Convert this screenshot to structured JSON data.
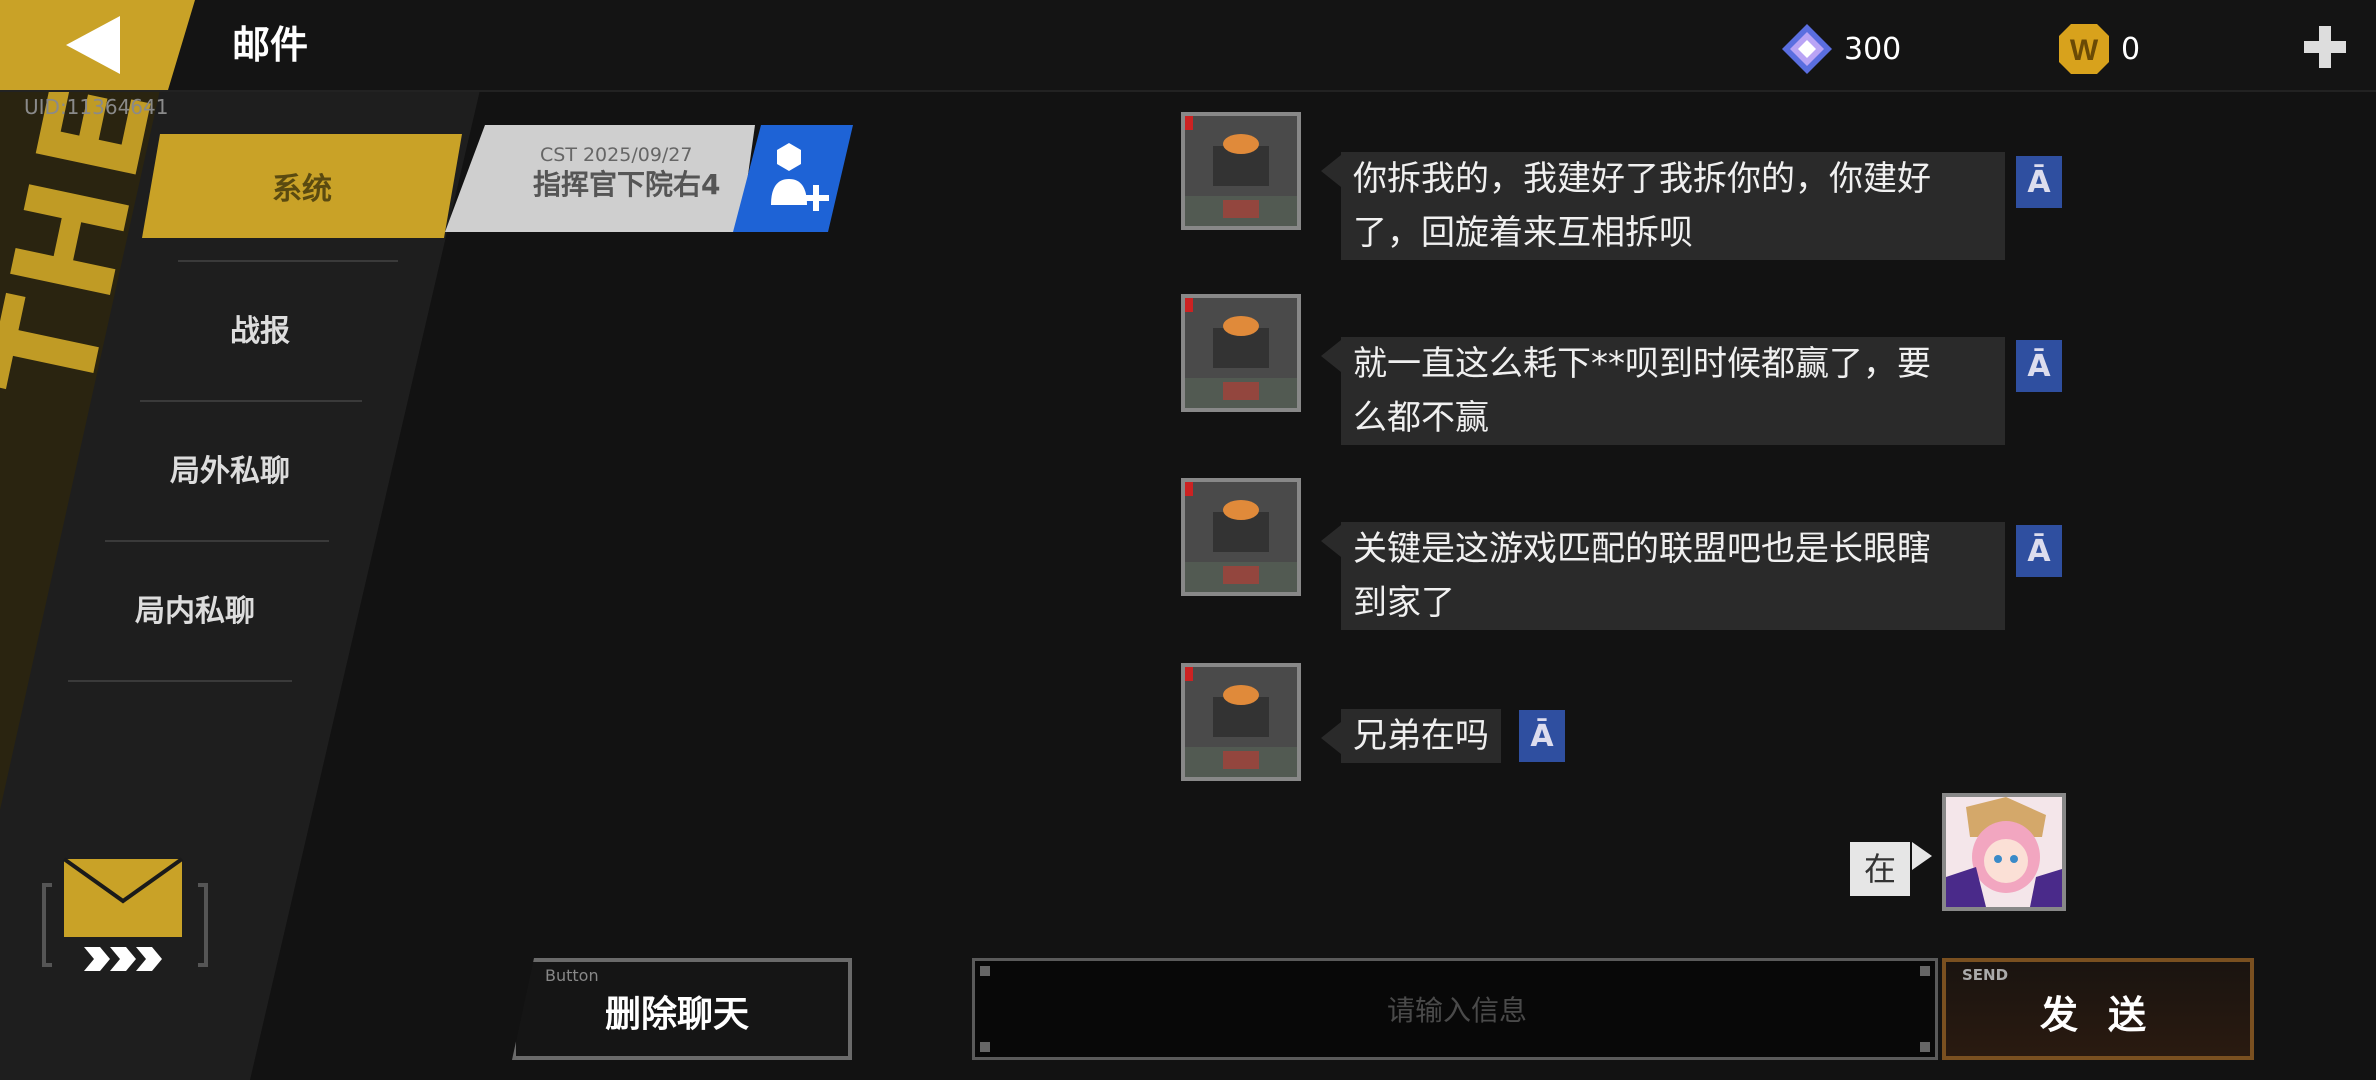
{
  "header": {
    "title": "邮件",
    "uid": "UID:11364641",
    "gem_count": "300",
    "gold_count": "0",
    "gold_symbol": "W"
  },
  "background_text": "THE WAR",
  "sidebar": {
    "items": [
      {
        "label": "系统",
        "active": true
      },
      {
        "label": "战报",
        "active": false
      },
      {
        "label": "局外私聊",
        "active": false
      },
      {
        "label": "局内私聊",
        "active": false
      }
    ]
  },
  "contact": {
    "date": "CST 2025/09/27",
    "name": "指挥官下院右4"
  },
  "messages": [
    {
      "from": "other",
      "line1": "你拆我的，我建好了我拆你的，你建好",
      "line2": "了，回旋着来互相拆呗"
    },
    {
      "from": "other",
      "line1": "就一直这么耗下**呗到时候都赢了，要",
      "line2": "么都不赢"
    },
    {
      "from": "other",
      "line1": "关键是这游戏匹配的联盟吧也是长眼瞎",
      "line2": "到家了"
    },
    {
      "from": "other",
      "line1": "兄弟在吗",
      "line2": ""
    },
    {
      "from": "me",
      "line1": "在",
      "line2": ""
    }
  ],
  "bottom": {
    "delete_sub": "Button",
    "delete_label": "删除聊天",
    "input_placeholder": "请输入信息",
    "send_sub": "SEND",
    "send_label": "发送"
  },
  "colors": {
    "accent_gold": "#c9a227",
    "blue": "#1e63d6",
    "translate_blue": "#2f4fa0",
    "send_border": "#7a5020"
  },
  "icons": [
    "back-arrow-icon",
    "diamond-gem-icon",
    "gold-coin-icon",
    "plus-icon",
    "add-friend-icon",
    "translate-icon",
    "mail-envelope-icon"
  ]
}
